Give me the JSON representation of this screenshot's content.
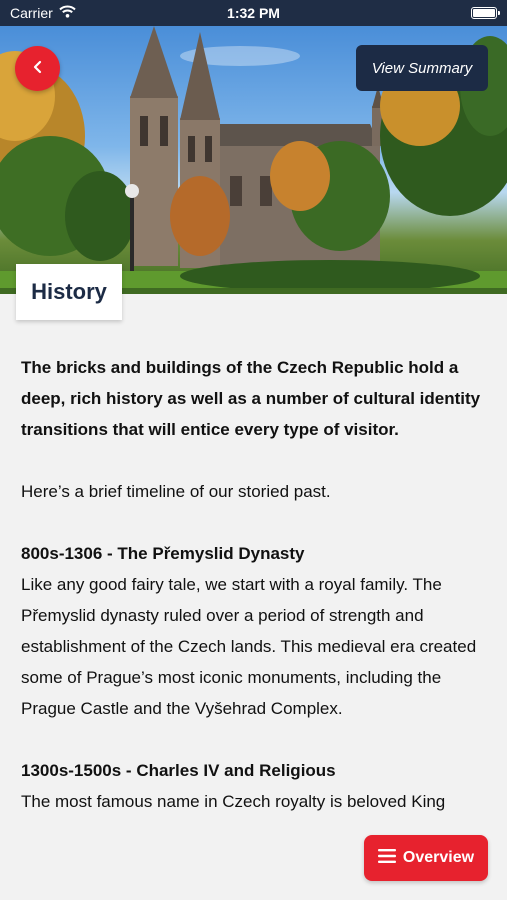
{
  "status_bar": {
    "carrier": "Carrier",
    "time": "1:32 PM"
  },
  "header": {
    "summary_label": "View Summary",
    "section_tab": "History"
  },
  "content": {
    "intro": "The bricks and buildings of the Czech Republic hold a deep, rich history as well as a number of cultural identity transitions that will entice every type of visitor.",
    "timeline_intro": "Here’s a brief timeline of our storied past.",
    "eras": [
      {
        "title": "800s-1306 - The Přemyslid Dynasty",
        "body": "Like any good fairy tale, we start with a royal family. The Přemyslid dynasty ruled over a period of strength and establishment of the Czech lands. This medieval era created some of Prague’s most iconic monuments, including the Prague Castle and the Vyšehrad Complex."
      },
      {
        "title": "1300s-1500s - Charles IV and Religious",
        "body": "The most famous name in Czech royalty is beloved King"
      }
    ]
  },
  "floating": {
    "overview_label": "Overview"
  },
  "icons": {
    "back": "chevron-left-icon",
    "menu": "menu-icon",
    "wifi": "wifi-icon",
    "battery": "battery-icon"
  },
  "colors": {
    "accent": "#e7222e",
    "navy": "#1c2b45",
    "background": "#f2f2f2"
  }
}
